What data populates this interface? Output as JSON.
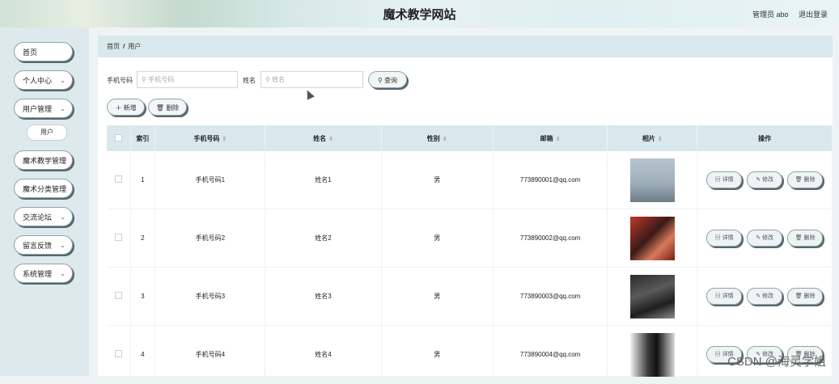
{
  "header": {
    "title": "魔术教学网站",
    "user": "管理员 abo",
    "logout": "退出登录"
  },
  "sidebar": {
    "items": [
      {
        "label": "首页",
        "chevron": false
      },
      {
        "label": "个人中心",
        "chevron": true
      },
      {
        "label": "用户管理",
        "chevron": true
      },
      {
        "label": "魔术教学管理",
        "chevron": false
      },
      {
        "label": "魔术分类管理",
        "chevron": false
      },
      {
        "label": "交流论坛",
        "chevron": true
      },
      {
        "label": "留言反馈",
        "chevron": true
      },
      {
        "label": "系统管理",
        "chevron": true
      }
    ],
    "sub_item": "用户"
  },
  "breadcrumb": {
    "home": "首页",
    "sep": "/",
    "current": "用户"
  },
  "search": {
    "phone_label": "手机号码",
    "phone_placeholder": "手机号码",
    "name_label": "姓名",
    "name_placeholder": "姓名",
    "query_button": "查询"
  },
  "actions": {
    "add": "新增",
    "delete": "删除"
  },
  "table": {
    "headers": [
      "索引",
      "手机号码",
      "姓名",
      "性别",
      "邮箱",
      "相片",
      "操作"
    ],
    "rows": [
      {
        "index": "1",
        "phone": "手机号码1",
        "name": "姓名1",
        "gender": "男",
        "email": "773890001@qq.com"
      },
      {
        "index": "2",
        "phone": "手机号码2",
        "name": "姓名2",
        "gender": "男",
        "email": "773890002@qq.com"
      },
      {
        "index": "3",
        "phone": "手机号码3",
        "name": "姓名3",
        "gender": "男",
        "email": "773890003@qq.com"
      },
      {
        "index": "4",
        "phone": "手机号码4",
        "name": "姓名4",
        "gender": "男",
        "email": "773890004@qq.com"
      }
    ],
    "row_actions": {
      "detail": "详情",
      "edit": "修改",
      "delete": "删除"
    }
  },
  "watermark": "CSDN @海灵学姐"
}
